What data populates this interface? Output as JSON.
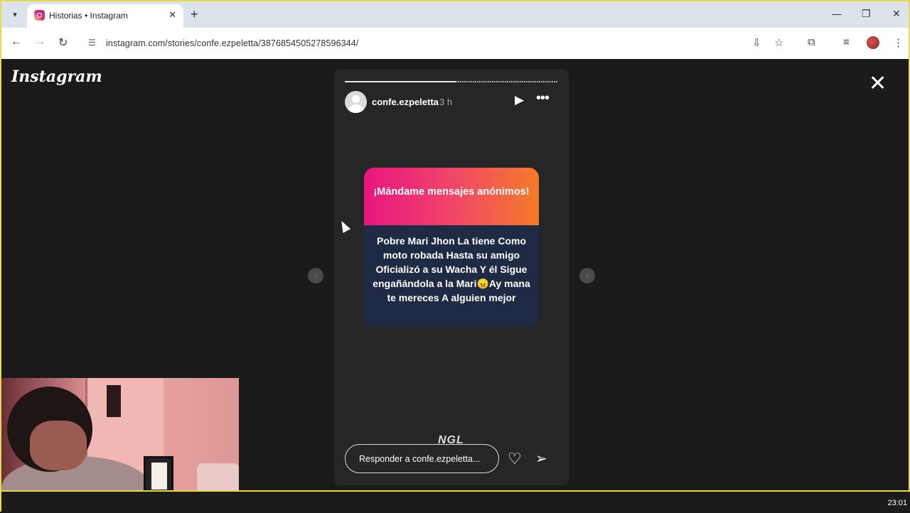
{
  "browser": {
    "tab_title": "Historias • Instagram",
    "tab_list_icon": "chevron-down-icon",
    "new_tab_label": "+",
    "tab_close": "✕",
    "url": "instagram.com/stories/confe.ezpeletta/3876854505278596344/",
    "window_controls": {
      "minimize": "—",
      "restore": "❐",
      "close": "✕"
    }
  },
  "page": {
    "logo": "Instagram",
    "close_icon": "✕",
    "story": {
      "username": "confe.ezpeletta",
      "time": "3 h",
      "progress": 0.52,
      "card_header": "¡Mándame mensajes anónimos!",
      "card_message": "Pobre Mari Jhon La tiene Como moto robada Hasta su amigo Oficializó a su Wacha Y él Sigue engañándola a la Mari😠Ay mana te mereces A alguien mejor",
      "sticker_label": "NGL",
      "reply_placeholder": "Responder a confe.ezpeletta..."
    },
    "colors": {
      "card_gradient_start": "#e8157f",
      "card_gradient_end": "#f47b28",
      "card_body": "#1f2a44",
      "highlight_border": "#e8d94a"
    }
  },
  "taskbar": {
    "clock": "23:01"
  }
}
